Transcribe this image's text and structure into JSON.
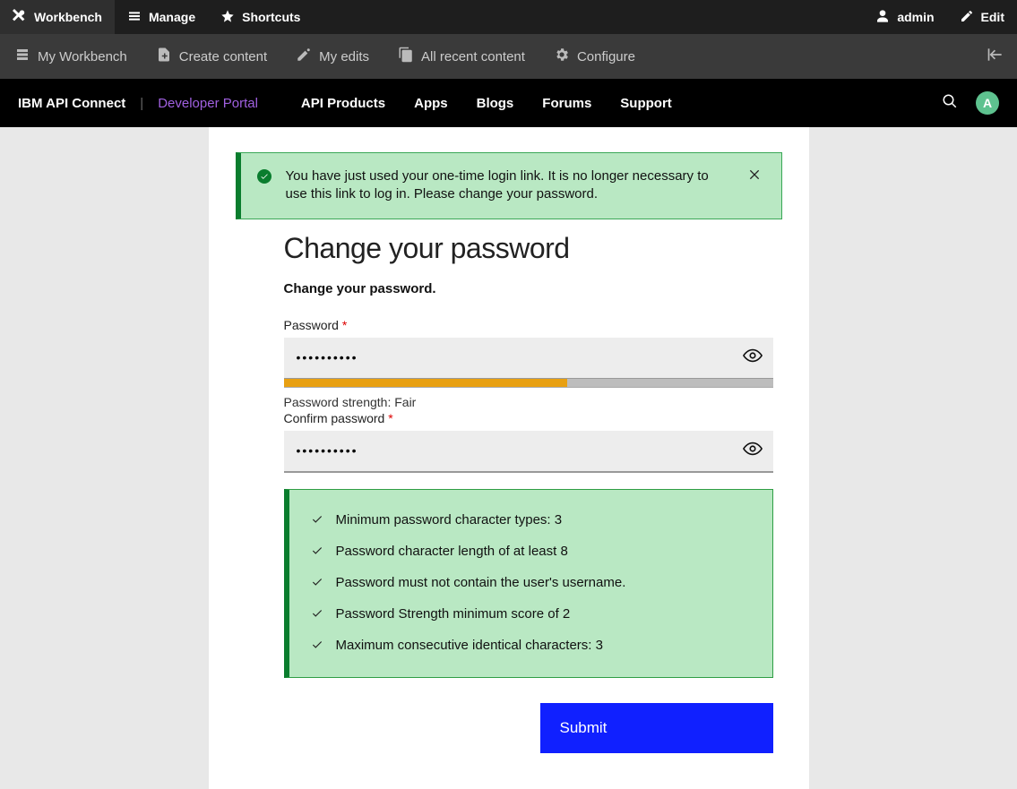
{
  "adminBar": {
    "workbench": "Workbench",
    "manage": "Manage",
    "shortcuts": "Shortcuts",
    "user": "admin",
    "edit": "Edit"
  },
  "toolbar": {
    "myWorkbench": "My Workbench",
    "createContent": "Create content",
    "myEdits": "My edits",
    "allRecent": "All recent content",
    "configure": "Configure"
  },
  "portalNav": {
    "brand": "IBM API Connect",
    "devPortal": "Developer Portal",
    "items": [
      "API Products",
      "Apps",
      "Blogs",
      "Forums",
      "Support"
    ],
    "avatarLetter": "A"
  },
  "alert": {
    "message": "You have just used your one-time login link. It is no longer necessary to use this link to log in. Please change your password."
  },
  "form": {
    "title": "Change your password",
    "subtitle": "Change your password.",
    "passwordLabel": "Password",
    "confirmLabel": "Confirm password",
    "required": "*",
    "passwordValue": "••••••••••",
    "confirmValue": "••••••••••",
    "strengthLabel": "Password strength:",
    "strengthValue": "Fair",
    "strengthPercent": 58,
    "rules": [
      "Minimum password character types: 3",
      "Password character length of at least 8",
      "Password must not contain the user's username.",
      "Password Strength minimum score of 2",
      "Maximum consecutive identical characters: 3"
    ],
    "submit": "Submit"
  }
}
